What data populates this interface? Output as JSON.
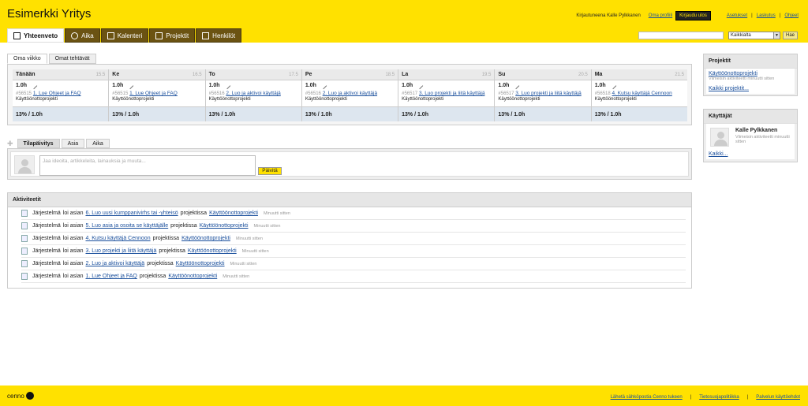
{
  "app": {
    "title": "Esimerkki Yritys"
  },
  "top": {
    "logged_in": "Kirjautuneena Kalle Pylkkanen",
    "profile": "Oma profiili",
    "logout": "Kirjaudu ulos",
    "settings": "Asetukset",
    "billing": "Laskutus",
    "help": "Ohjeet"
  },
  "nav": {
    "tabs": [
      {
        "label": "Yhteenveto",
        "icon": "summary-icon"
      },
      {
        "label": "Aika",
        "icon": "clock-icon"
      },
      {
        "label": "Kalenteri",
        "icon": "calendar-icon"
      },
      {
        "label": "Projektit",
        "icon": "folder-icon"
      },
      {
        "label": "Henkilöt",
        "icon": "people-icon"
      }
    ]
  },
  "search": {
    "value": "",
    "scope": "Kaikkialta",
    "button": "Hae"
  },
  "week": {
    "tabs": [
      "Oma viikko",
      "Omat tehtävät"
    ],
    "days": [
      {
        "name": "Tänään",
        "date": "15.5",
        "hours": "1.0h",
        "task_id": "#56515",
        "task": "1. Lue Ohjeet ja FAQ",
        "project": "Käyttöönottoprojekti",
        "total": "13% / 1.0h"
      },
      {
        "name": "Ke",
        "date": "16.5",
        "hours": "1.0h",
        "task_id": "#56515",
        "task": "1. Lue Ohjeet ja FAQ",
        "project": "Käyttöönottoprojekti",
        "total": "13% / 1.0h"
      },
      {
        "name": "To",
        "date": "17.5",
        "hours": "1.0h",
        "task_id": "#56516",
        "task": "2. Luo ja aktivoi käyttäjä",
        "project": "Käyttöönottoprojekti",
        "total": "13% / 1.0h"
      },
      {
        "name": "Pe",
        "date": "18.5",
        "hours": "1.0h",
        "task_id": "#56516",
        "task": "2. Luo ja aktivoi käyttäjä",
        "project": "Käyttöönottoprojekti",
        "total": "13% / 1.0h"
      },
      {
        "name": "La",
        "date": "19.5",
        "hours": "1.0h",
        "task_id": "#56517",
        "task": "3. Luo projekti ja liitä käyttäjä",
        "project": "Käyttöönottoprojekti",
        "total": "13% / 1.0h"
      },
      {
        "name": "Su",
        "date": "20.5",
        "hours": "1.0h",
        "task_id": "#56517",
        "task": "3. Luo projekti ja liitä käyttäjä",
        "project": "Käyttöönottoprojekti",
        "total": "13% / 1.0h"
      },
      {
        "name": "Ma",
        "date": "21.5",
        "hours": "1.0h",
        "task_id": "#56518",
        "task": "4. Kutsu käyttäjä Cennoon",
        "project": "Käyttöönottoprojekti",
        "total": "13% / 1.0h"
      }
    ]
  },
  "status": {
    "tabs": [
      "Tilapäivitys",
      "Asia",
      "Aika"
    ],
    "placeholder": "Jaa ideoita, artikkeleita, lainauksia ja muuta...",
    "button": "Päivitä"
  },
  "activity": {
    "title": "Aktiviteetit",
    "items": [
      {
        "actor": "Järjestelmä",
        "verb": "loi asian",
        "task": "6. Luo uusi kumppanivirhs tai -yhteisö",
        "in": "projektissa",
        "project": "Käyttöönottoprojekti",
        "time": "Minuutti sitten"
      },
      {
        "actor": "Järjestelmä",
        "verb": "loi asian",
        "task": "5. Luo asia ja osoita se käyttäjälle",
        "in": "projektissa",
        "project": "Käyttöönottoprojekti",
        "time": "Minuutti sitten"
      },
      {
        "actor": "Järjestelmä",
        "verb": "loi asian",
        "task": "4. Kutsu käyttäjä Cennoon",
        "in": "projektissa",
        "project": "Käyttöönottoprojekti",
        "time": "Minuutti sitten"
      },
      {
        "actor": "Järjestelmä",
        "verb": "loi asian",
        "task": "3. Luo projekti ja liitä käyttäjä",
        "in": "projektissa",
        "project": "Käyttöönottoprojekti",
        "time": "Minuutti sitten"
      },
      {
        "actor": "Järjestelmä",
        "verb": "loi asian",
        "task": "2. Luo ja aktivoi käyttäjä",
        "in": "projektissa",
        "project": "Käyttöönottoprojekti",
        "time": "Minuutti sitten"
      },
      {
        "actor": "Järjestelmä",
        "verb": "loi asian",
        "task": "1. Lue Ohjeet ja FAQ",
        "in": "projektissa",
        "project": "Käyttöönottoprojekti",
        "time": "Minuutti sitten"
      }
    ]
  },
  "sidebar": {
    "projects": {
      "title": "Projektit",
      "item": "Käyttöönottoprojekti",
      "item_sub": "Viimeisin aktiviteetti minuutti sitten",
      "all": "Kaikki projektit..."
    },
    "users": {
      "title": "Käyttäjät",
      "name": "Kalle Pylkkanen",
      "sub": "Viimeisin aktiviteetti minuutti sitten",
      "all": "Kaikki..."
    }
  },
  "footer": {
    "logo": "cenno",
    "links": [
      "Lähetä sähköpostia Cenno tukeen",
      "Tietosuojapolitiikka",
      "Palvelun käyttöehdot"
    ]
  }
}
